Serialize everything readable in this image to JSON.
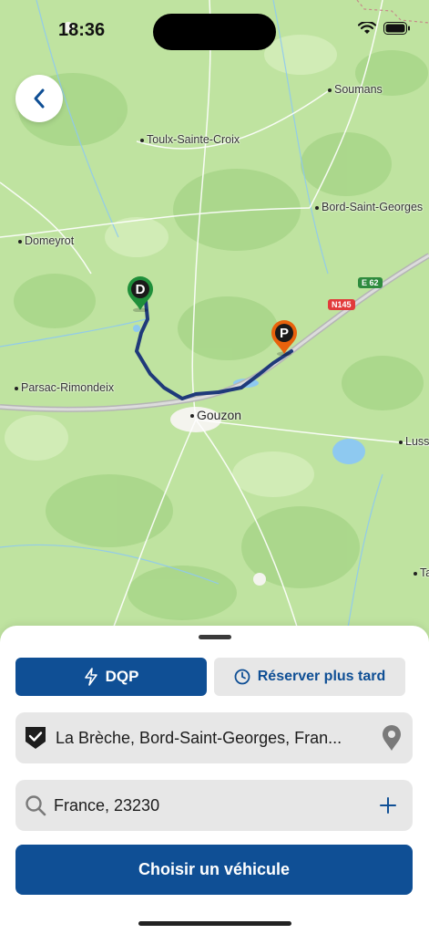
{
  "status": {
    "time": "18:36"
  },
  "map": {
    "places": [
      "Soumans",
      "Toulx-Sainte-Croix",
      "Bord-Saint-Georges",
      "Domeyrot",
      "Parsac-Rimondeix",
      "Gouzon",
      "Luss",
      "Ta"
    ],
    "road_shields": [
      "E 62",
      "N145"
    ],
    "markers": {
      "departure": "D",
      "parking": "P"
    }
  },
  "actions": {
    "dqp_label": "DQP",
    "reserve_label": "Réserver plus tard"
  },
  "fields": {
    "origin_value": "La Brèche, Bord-Saint-Georges, Fran...",
    "destination_value": "France, 23230"
  },
  "cta_label": "Choisir un véhicule",
  "colors": {
    "primary": "#0f4f95",
    "departure_pin": "#1f8f3a",
    "parking_pin": "#e8620c",
    "route": "#1f3a7a"
  }
}
